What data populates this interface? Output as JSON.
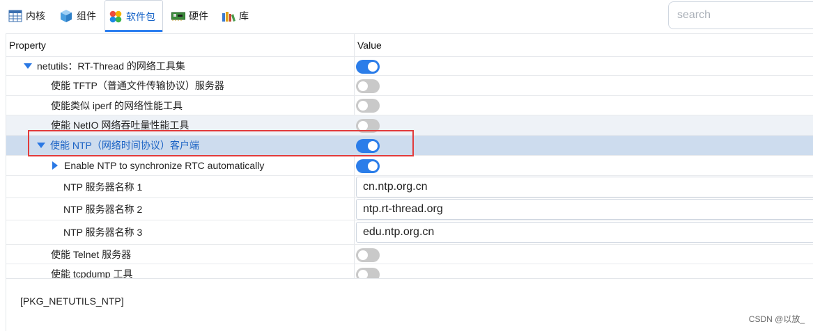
{
  "tabs": [
    {
      "label": "内核",
      "icon": "table-icon",
      "active": false
    },
    {
      "label": "组件",
      "icon": "cube-icon",
      "active": false
    },
    {
      "label": "软件包",
      "icon": "packages-icon",
      "active": true
    },
    {
      "label": "硬件",
      "icon": "board-icon",
      "active": false
    },
    {
      "label": "库",
      "icon": "books-icon",
      "active": false
    }
  ],
  "search": {
    "placeholder": "search",
    "value": ""
  },
  "grid": {
    "header": {
      "property": "Property",
      "value": "Value"
    },
    "rows": [
      {
        "label": "netutils：RT-Thread 的网络工具集",
        "kind": "toggle",
        "on": true,
        "caret": "down",
        "state": "normal"
      },
      {
        "label": "使能 TFTP（普通文件传输协议）服务器",
        "kind": "toggle",
        "on": false,
        "state": "normal"
      },
      {
        "label": "使能类似 iperf 的网络性能工具",
        "kind": "toggle",
        "on": false,
        "state": "normal"
      },
      {
        "label": "使能 NetIO 网络吞吐量性能工具",
        "kind": "toggle",
        "on": false,
        "state": "hover"
      },
      {
        "label": "使能 NTP（网络时间协议）客户端",
        "kind": "toggle",
        "on": true,
        "caret": "down",
        "state": "selected"
      },
      {
        "label": "Enable NTP to synchronize RTC automatically",
        "kind": "toggle",
        "on": true,
        "caret": "right",
        "state": "normal"
      },
      {
        "label": "NTP 服务器名称 1",
        "kind": "input",
        "value": "cn.ntp.org.cn",
        "state": "normal"
      },
      {
        "label": "NTP 服务器名称 2",
        "kind": "input",
        "value": "ntp.rt-thread.org",
        "state": "normal"
      },
      {
        "label": "NTP 服务器名称 3",
        "kind": "input",
        "value": "edu.ntp.org.cn",
        "state": "normal"
      },
      {
        "label": "使能 Telnet 服务器",
        "kind": "toggle",
        "on": false,
        "state": "normal"
      },
      {
        "label": "使能 tcpdump 工具",
        "kind": "toggle",
        "on": false,
        "state": "normal"
      }
    ]
  },
  "bottom": {
    "symbol": "[PKG_NETUTILS_NTP]"
  },
  "watermark": "CSDN @以放_",
  "colors": {
    "accent": "#2b7de9",
    "toggle_off": "#c9c9c9",
    "selected_row": "#cddcee",
    "highlight": "#e23b3b"
  }
}
